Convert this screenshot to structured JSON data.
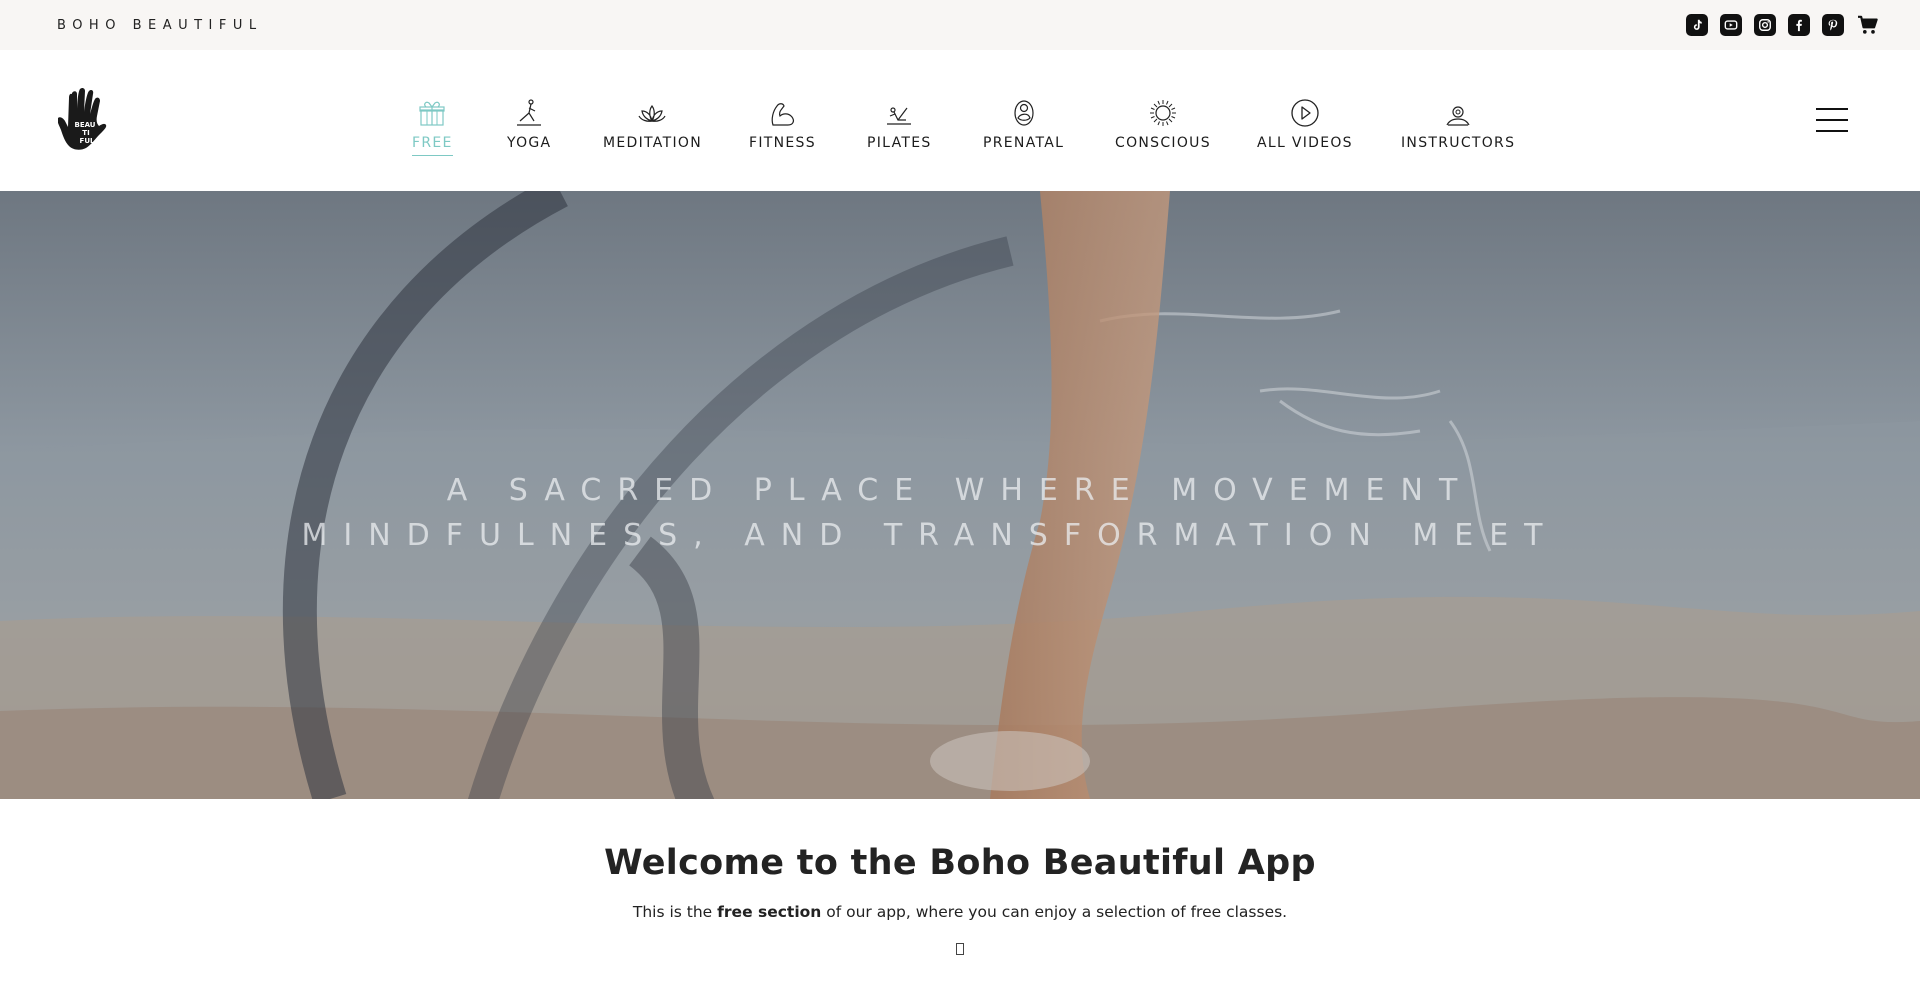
{
  "topbar": {
    "brand": "BOHO BEAUTIFUL",
    "social": [
      {
        "name": "tiktok-icon"
      },
      {
        "name": "youtube-icon"
      },
      {
        "name": "instagram-icon"
      },
      {
        "name": "facebook-icon"
      },
      {
        "name": "pinterest-icon"
      },
      {
        "name": "cart-icon"
      }
    ]
  },
  "nav": {
    "active": "FREE",
    "accent_color": "#7ec9c4",
    "items": [
      {
        "label": "FREE",
        "icon": "gift-icon"
      },
      {
        "label": "YOGA",
        "icon": "yoga-pose-icon"
      },
      {
        "label": "MEDITATION",
        "icon": "lotus-icon"
      },
      {
        "label": "FITNESS",
        "icon": "flexed-arm-icon"
      },
      {
        "label": "PILATES",
        "icon": "pilates-pose-icon"
      },
      {
        "label": "PRENATAL",
        "icon": "prenatal-icon"
      },
      {
        "label": "CONSCIOUS",
        "icon": "sun-icon"
      },
      {
        "label": "ALL VIDEOS",
        "icon": "play-circle-icon"
      },
      {
        "label": "INSTRUCTORS",
        "icon": "person-icon"
      }
    ]
  },
  "hero": {
    "line1": "A SACRED PLACE WHERE MOVEMENT",
    "line2": "MINDFULNESS, AND TRANSFORMATION MEET"
  },
  "welcome": {
    "title": "Welcome to the Boho Beautiful App",
    "intro_prefix": "This is the",
    "intro_bold": "free section",
    "intro_suffix": "of our app, where you can enjoy a selection of free classes."
  }
}
